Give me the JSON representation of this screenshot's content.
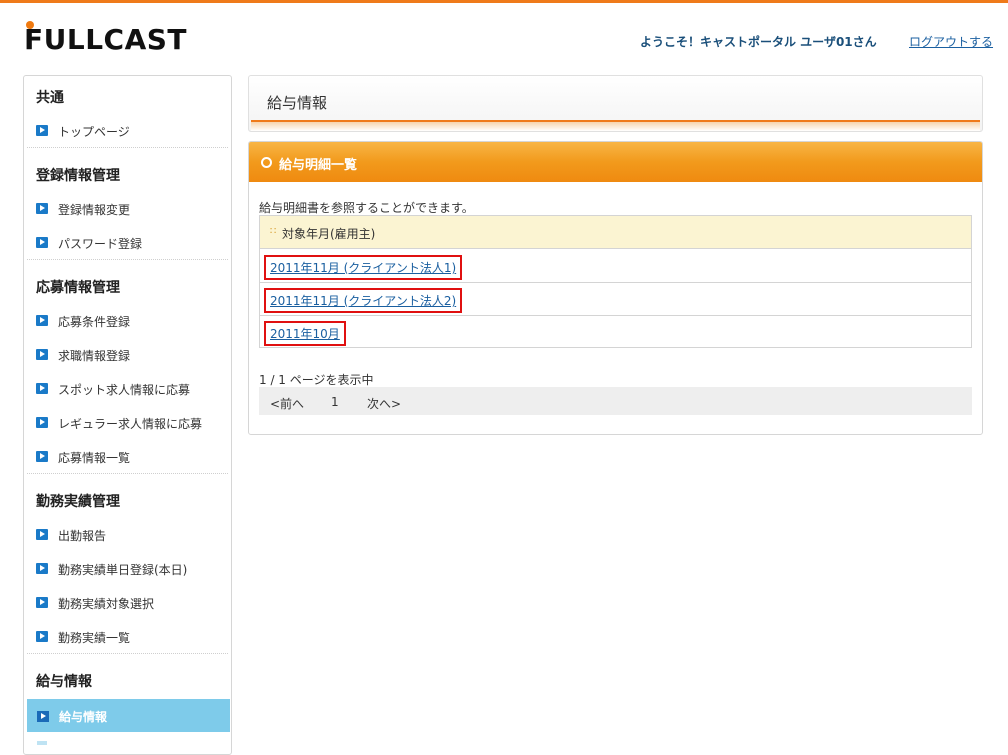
{
  "header": {
    "logo": "FULLCAST",
    "welcome": "ようこそ！キャストポータル ユーザ01さん",
    "logout": "ログアウトする"
  },
  "sidebar": {
    "sections": [
      {
        "title": "共通",
        "items": [
          "トップページ"
        ]
      },
      {
        "title": "登録情報管理",
        "items": [
          "登録情報変更",
          "パスワード登録"
        ]
      },
      {
        "title": "応募情報管理",
        "items": [
          "応募条件登録",
          "求職情報登録",
          "スポット求人情報に応募",
          "レギュラー求人情報に応募",
          "応募情報一覧"
        ]
      },
      {
        "title": "勤務実績管理",
        "items": [
          "出勤報告",
          "勤務実績単日登録(本日)",
          "勤務実績対象選択",
          "勤務実績一覧"
        ]
      },
      {
        "title": "給与情報",
        "items": [
          "給与情報"
        ]
      }
    ],
    "active_item": "給与情報"
  },
  "main": {
    "page_title": "給与情報",
    "panel_title": "給与明細一覧",
    "description": "給与明細書を参照することができます。",
    "list_header": "対象年月(雇用主)",
    "rows": [
      "2011年11月 (クライアント法人1)",
      "2011年11月 (クライアント法人2)",
      "2011年10月"
    ],
    "page_info": "1 / 1 ページを表示中",
    "pager": {
      "prev": "<前へ",
      "current": "1",
      "next": "次へ>"
    }
  },
  "colors": {
    "accent": "#ef7a1a",
    "link": "#1a5fa0",
    "active_nav": "#7ecbea",
    "highlight_box": "#e01010"
  },
  "icons": [
    "arrow-right-icon",
    "circle-icon",
    "dots-icon"
  ]
}
